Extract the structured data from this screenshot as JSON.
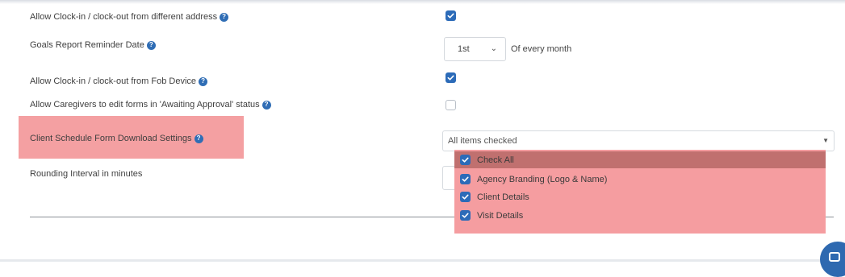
{
  "settings": {
    "clock_in_address_label": "Allow Clock-in / clock-out from different address",
    "clock_in_address_checked": true,
    "goals_report_label": "Goals Report Reminder Date",
    "goals_report_day": "1st",
    "goals_report_suffix": "Of every month",
    "fob_device_label": "Allow Clock-in / clock-out from Fob Device",
    "fob_device_checked": true,
    "caregivers_edit_label": "Allow Caregivers to edit forms in 'Awaiting Approval' status",
    "caregivers_edit_checked": false,
    "download_settings_label": "Client Schedule Form Download Settings",
    "download_settings_value": "All items checked",
    "rounding_label": "Rounding Interval in minutes"
  },
  "dropdown": {
    "items": [
      {
        "label": "Check All",
        "checked": true
      },
      {
        "label": "Agency Branding (Logo & Name)",
        "checked": true
      },
      {
        "label": "Client Details",
        "checked": true
      },
      {
        "label": "Visit Details",
        "checked": true
      }
    ]
  },
  "icons": {
    "help": "question-circle-icon",
    "check": "checkmark-icon",
    "chat": "chat-icon"
  },
  "colors": {
    "accent": "#2c6bb8",
    "highlight": "#f4a0a2"
  }
}
